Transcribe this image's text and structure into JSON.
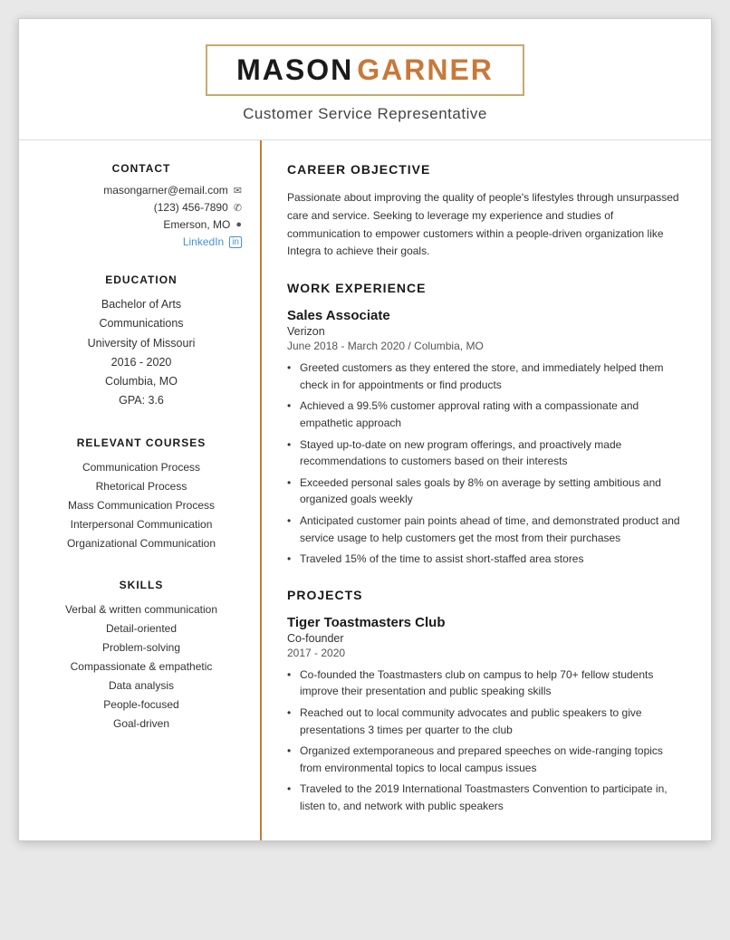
{
  "header": {
    "name_first": "MASON",
    "name_last": "GARNER",
    "title": "Customer Service Representative"
  },
  "sidebar": {
    "contact_heading": "CONTACT",
    "email": "masongarner@email.com",
    "phone": "(123) 456-7890",
    "location": "Emerson, MO",
    "linkedin_label": "LinkedIn",
    "education_heading": "EDUCATION",
    "degree": "Bachelor of Arts",
    "major": "Communications",
    "university": "University of Missouri",
    "years": "2016 - 2020",
    "city": "Columbia, MO",
    "gpa": "GPA: 3.6",
    "courses_heading": "RELEVANT COURSES",
    "courses": [
      "Communication Process",
      "Rhetorical Process",
      "Mass Communication Process",
      "Interpersonal Communication",
      "Organizational Communication"
    ],
    "skills_heading": "SKILLS",
    "skills": [
      "Verbal & written communication",
      "Detail-oriented",
      "Problem-solving",
      "Compassionate & empathetic",
      "Data analysis",
      "People-focused",
      "Goal-driven"
    ]
  },
  "main": {
    "career_heading": "CAREER OBJECTIVE",
    "career_text": "Passionate about improving the quality of people's lifestyles through unsurpassed care and service. Seeking to leverage my experience and studies of communication to empower customers within a people-driven organization like Integra to achieve their goals.",
    "work_heading": "WORK EXPERIENCE",
    "jobs": [
      {
        "title": "Sales Associate",
        "company": "Verizon",
        "meta": "June 2018 - March 2020  /  Columbia, MO",
        "bullets": [
          "Greeted customers as they entered the store, and immediately helped them check in for appointments or find products",
          "Achieved a 99.5% customer approval rating with a compassionate and empathetic approach",
          "Stayed up-to-date on new program offerings, and proactively made recommendations to customers based on their interests",
          "Exceeded personal sales goals by 8% on average by setting ambitious and organized goals weekly",
          "Anticipated customer pain points ahead of time, and demonstrated product and service usage to help customers get the most from their purchases",
          "Traveled 15% of the time to assist short-staffed area stores"
        ]
      }
    ],
    "projects_heading": "PROJECTS",
    "projects": [
      {
        "title": "Tiger Toastmasters Club",
        "role": "Co-founder",
        "years": "2017 - 2020",
        "bullets": [
          "Co-founded the Toastmasters club on campus to help 70+ fellow students improve their presentation and public speaking skills",
          "Reached out to local community advocates and public speakers to give presentations 3 times per quarter to the club",
          "Organized extemporaneous and prepared speeches on wide-ranging topics from environmental topics to local campus issues",
          "Traveled to the 2019 International Toastmasters Convention to participate in, listen to, and network with public speakers"
        ]
      }
    ]
  },
  "icons": {
    "email": "✉",
    "phone": "✆",
    "location": "📍",
    "linkedin": "in"
  }
}
